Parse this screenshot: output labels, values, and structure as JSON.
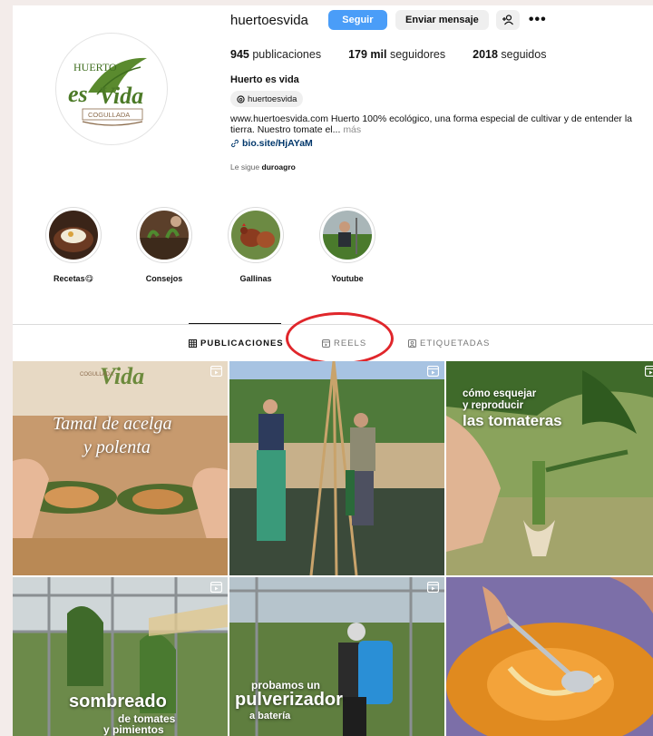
{
  "profile": {
    "username": "huertoesvida",
    "follow_label": "Seguir",
    "message_label": "Enviar mensaje",
    "more_label": "•••",
    "stats": {
      "posts_count": "945",
      "posts_label": "publicaciones",
      "followers_count": "179 mil",
      "followers_label": "seguidores",
      "following_count": "2018",
      "following_label": "seguidos"
    },
    "full_name": "Huerto es vida",
    "threads_handle": "huertoesvida",
    "bio_text": "www.huertoesvida.com Huerto 100% ecológico, una forma especial de cultivar y de entender la tierra. Nuestro tomate el...",
    "bio_more": "más",
    "link": "bio.site/HjAYaM",
    "followed_by_prefix": "Le sigue",
    "followed_by_user": "duroagro"
  },
  "logo": {
    "line1": "HUERTO",
    "line2a": "es",
    "line2b": "Vida",
    "line3": "COGULLADA"
  },
  "highlights": [
    {
      "label": "Recetas😋"
    },
    {
      "label": "Consejos"
    },
    {
      "label": "Gallinas"
    },
    {
      "label": "Youtube"
    }
  ],
  "tabs": [
    {
      "label": "PUBLICACIONES",
      "active": true
    },
    {
      "label": "REELS",
      "active": false
    },
    {
      "label": "ETIQUETADAS",
      "active": false
    }
  ],
  "posts": [
    {
      "overlay_line1": "Tamal de acelga",
      "overlay_line2": "y polenta",
      "header_text": "Vida",
      "header_sub": "COGULLADA"
    },
    {
      "overlay": ""
    },
    {
      "overlay_line1": "cómo esquejar",
      "overlay_line2": "y reproducir",
      "overlay_line3": "las tomateras"
    },
    {
      "overlay_line1": "sombreado",
      "overlay_line2": "de tomates",
      "overlay_line3": "y pimientos"
    },
    {
      "overlay_line1": "probamos un",
      "overlay_line2": "pulverizador",
      "overlay_line3": "a batería"
    },
    {
      "overlay": ""
    }
  ],
  "colors": {
    "follow_button": "#4a9df8",
    "annotation_circle": "#e0262b",
    "brand_green": "#5a8a2e"
  }
}
